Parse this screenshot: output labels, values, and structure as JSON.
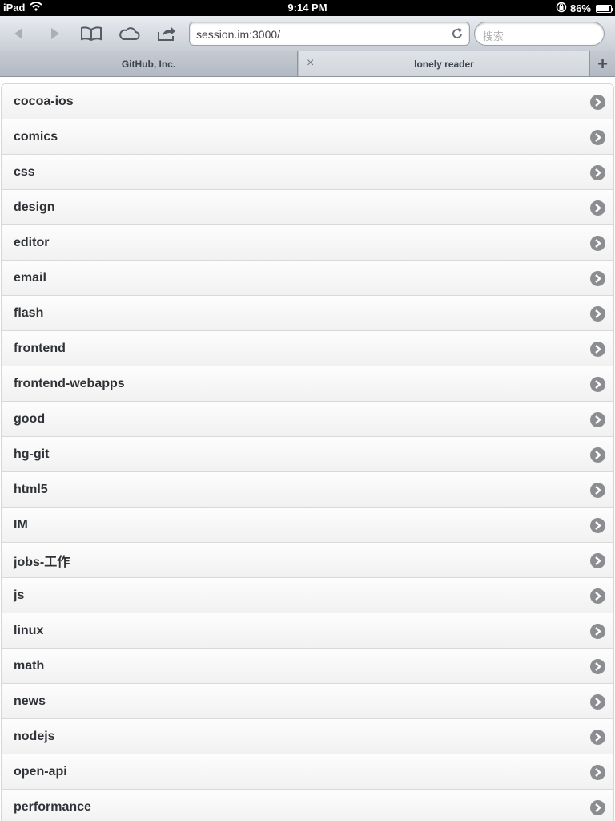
{
  "status_bar": {
    "device": "iPad",
    "time": "9:14 PM",
    "battery": "86%",
    "battery_level": 0.86,
    "icons": [
      "wifi-icon",
      "rotation-lock-icon",
      "battery-icon"
    ]
  },
  "toolbar": {
    "url": "session.im:3000/",
    "search_placeholder": "搜索",
    "icons": [
      "back-icon",
      "forward-icon",
      "bookmarks-icon",
      "icloud-tabs-icon",
      "share-icon",
      "reload-icon"
    ]
  },
  "tabs": {
    "items": [
      {
        "label": "GitHub, Inc.",
        "active": false
      },
      {
        "label": "lonely reader",
        "active": true
      }
    ],
    "close_glyph": "×",
    "add_glyph": "+"
  },
  "list": {
    "items": [
      "cocoa-ios",
      "comics",
      "css",
      "design",
      "editor",
      "email",
      "flash",
      "frontend",
      "frontend-webapps",
      "good",
      "hg-git",
      "html5",
      "IM",
      "jobs-工作",
      "js",
      "linux",
      "math",
      "news",
      "nodejs",
      "open-api",
      "performance"
    ]
  },
  "colors": {
    "status_bar": "#000000",
    "toolbar_top": "#e8ebef",
    "toolbar_bottom": "#c9ced6",
    "row_text": "#2f3236",
    "chevron": "#8b8d90"
  }
}
